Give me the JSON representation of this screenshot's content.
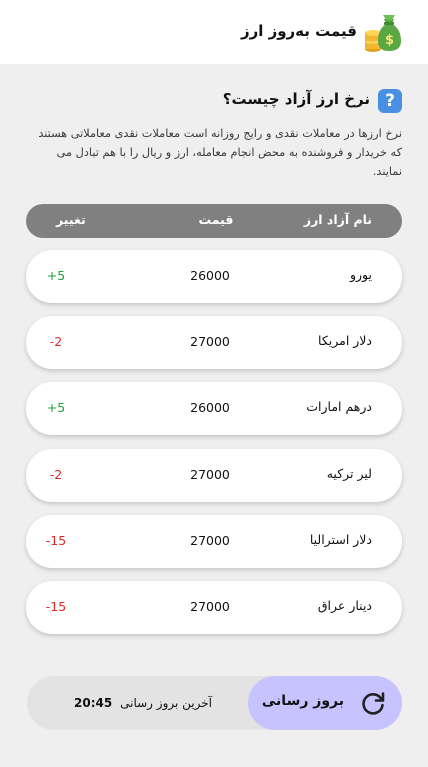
{
  "app": {
    "title": "قیمت به‌روز ارز"
  },
  "faq": {
    "question": "نرخ ارز آزاد چیست؟",
    "answer": "نرخ ارزها در معاملات نقدی و رایج روزانه است معاملات نقدی معاملاتی هستند که خریدار و فروشنده به محض انجام معامله، ارز و ریال را با هم تبادل می نمایند."
  },
  "table": {
    "headers": {
      "name": "نام آزاد ارز",
      "price": "قیمت",
      "change": "تغییر"
    },
    "rows": [
      {
        "name": "یورو",
        "price": "26000",
        "change": "+5",
        "trend": "up"
      },
      {
        "name": "دلار امریکا",
        "price": "27000",
        "change": "-2",
        "trend": "down"
      },
      {
        "name": "درهم امارات",
        "price": "26000",
        "change": "+5",
        "trend": "up"
      },
      {
        "name": "لیر ترکیه",
        "price": "27000",
        "change": "-2",
        "trend": "down"
      },
      {
        "name": "دلار استرالیا",
        "price": "27000",
        "change": "-15",
        "trend": "down"
      },
      {
        "name": "دینار عراق",
        "price": "27000",
        "change": "-15",
        "trend": "down"
      }
    ]
  },
  "footer": {
    "refresh_label": "بروز رسانی",
    "last_update_label": "آخرین بروز رسانی",
    "last_update_time": "20:45"
  },
  "colors": {
    "positive": "#1aa33a",
    "negative": "#e02a2a",
    "refresh_button": "#c7c3ff",
    "table_header": "#808080",
    "help_icon": "#4a90e2"
  },
  "icons": {
    "logo": "money-bag-coins-icon",
    "help": "question-mark-icon",
    "refresh": "refresh-icon"
  }
}
